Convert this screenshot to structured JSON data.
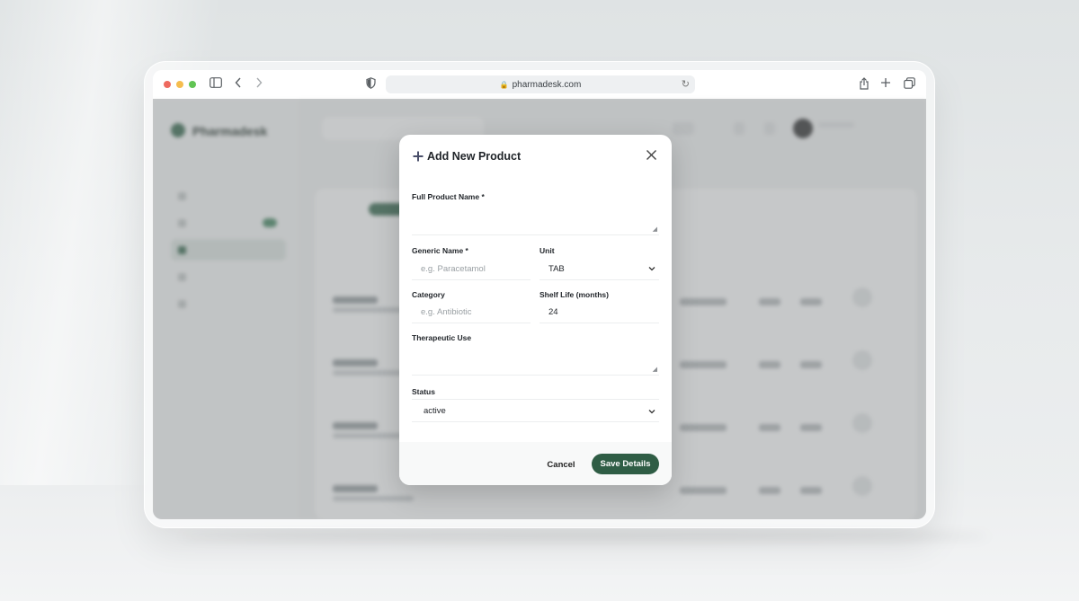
{
  "browser": {
    "url": "pharmadesk.com",
    "traffic_colors": [
      "#ee6a5f",
      "#f5bd4f",
      "#61c454"
    ]
  },
  "background_app": {
    "brand": "Pharmadesk",
    "accent": "#3e6e55"
  },
  "modal": {
    "title": "Add New Product",
    "full_name_label": "Full Product Name *",
    "full_name_value": "",
    "generic_label": "Generic Name *",
    "generic_placeholder": "e.g. Paracetamol",
    "unit_label": "Unit",
    "unit_value": "TAB",
    "category_label": "Category",
    "category_placeholder": "e.g. Antibiotic",
    "shelf_label": "Shelf Life (months)",
    "shelf_value": "24",
    "therapeutic_label": "Therapeutic Use",
    "therapeutic_value": "",
    "status_label": "Status",
    "status_value": "active",
    "cancel_label": "Cancel",
    "save_label": "Save Details",
    "save_color": "#2f5d45"
  }
}
